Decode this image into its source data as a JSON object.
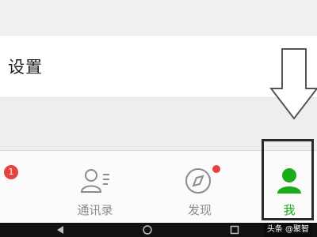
{
  "settings": {
    "label": "设置"
  },
  "tabs": [
    {
      "label": "",
      "icon": "chat-icon",
      "badge": "1",
      "active": false
    },
    {
      "label": "通讯录",
      "icon": "contacts-icon",
      "active": false
    },
    {
      "label": "发现",
      "icon": "compass-icon",
      "has_dot": true,
      "active": false
    },
    {
      "label": "我",
      "icon": "me-icon",
      "active": true
    }
  ],
  "watermark": "头条 @聚智",
  "colors": {
    "active": "#1aad19",
    "inactive": "#8c8c8c",
    "badge": "#e64340",
    "highlight": "#2a2a2a"
  }
}
